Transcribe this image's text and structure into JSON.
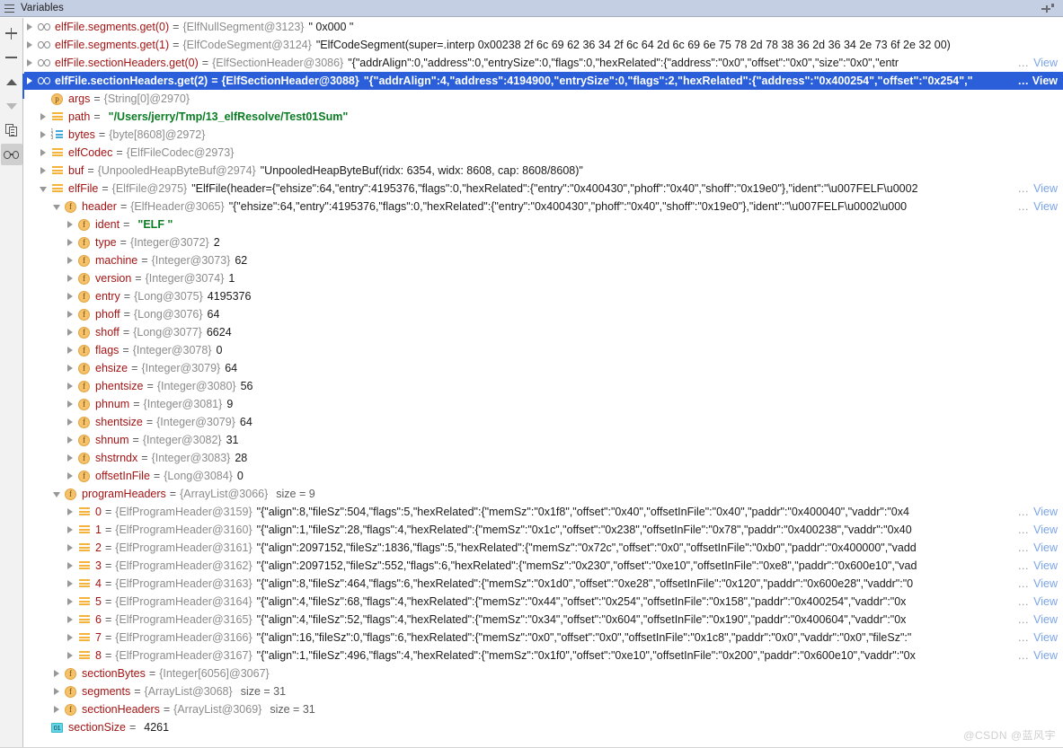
{
  "window": {
    "title": "Variables",
    "menu_icon": "hamburger-icon",
    "settings_icon": "pin-settings-icon"
  },
  "toolbar": {
    "buttons": [
      {
        "name": "add-watch-button",
        "glyph": "+",
        "label": "Add"
      },
      {
        "name": "remove-watch-button",
        "glyph": "−",
        "label": "Remove"
      },
      {
        "name": "move-up-button",
        "glyph": "▲",
        "label": "Up"
      },
      {
        "name": "move-down-button",
        "glyph": "▼",
        "label": "Down"
      },
      {
        "name": "copy-value-button",
        "glyph": "copy",
        "label": "Copy Value"
      },
      {
        "name": "watches-toggle-button",
        "glyph": "oo",
        "label": "Watches"
      }
    ]
  },
  "labels": {
    "equals": "=",
    "view": "View",
    "ellipsis": "…",
    "size_prefix": "size = "
  },
  "watermark": {
    "text": "@CSDN @蓝风宇"
  },
  "rows": [
    {
      "indent": 0,
      "arrow": "closed",
      "icon": "watch",
      "name": "elfFile.segments.get(0)",
      "type": "{ElfNullSegment@3123}",
      "value": "\" 0x000 \"",
      "value_kind": "plain",
      "view": false
    },
    {
      "indent": 0,
      "arrow": "closed",
      "icon": "watch",
      "name": "elfFile.segments.get(1)",
      "type": "{ElfCodeSegment@3124}",
      "value": "\"ElfCodeSegment(super=.interp 0x00238  2f 6c 69 62 36 34 2f 6c 64 2d 6c 69 6e 75 78 2d 78 38 36 2d 36 34 2e 73 6f 2e 32 00)",
      "value_kind": "plain",
      "view": false
    },
    {
      "indent": 0,
      "arrow": "closed",
      "icon": "watch",
      "name": "elfFile.sectionHeaders.get(0)",
      "type": "{ElfSectionHeader@3086}",
      "value": "\"{\"addrAlign\":0,\"address\":0,\"entrySize\":0,\"flags\":0,\"hexRelated\":{\"address\":\"0x0\",\"offset\":\"0x0\",\"size\":\"0x0\",\"entr",
      "value_kind": "plain",
      "view": true
    },
    {
      "indent": 0,
      "arrow": "closed",
      "icon": "watch",
      "name": "elfFile.sectionHeaders.get(2)",
      "type": "{ElfSectionHeader@3088}",
      "value": "\"{\"addrAlign\":4,\"address\":4194900,\"entrySize\":0,\"flags\":2,\"hexRelated\":{\"address\":\"0x400254\",\"offset\":\"0x254\",\"",
      "value_kind": "plain",
      "view": true,
      "selected": true
    },
    {
      "indent": 1,
      "arrow": "none",
      "icon": "param",
      "name": "args",
      "type": "{String[0]@2970}",
      "value": "",
      "value_kind": "plain",
      "view": false
    },
    {
      "indent": 1,
      "arrow": "closed",
      "icon": "object",
      "name": "path",
      "type": "",
      "value": "\"/Users/jerry/Tmp/13_elfResolve/Test01Sum\"",
      "value_kind": "string",
      "view": false
    },
    {
      "indent": 1,
      "arrow": "closed",
      "icon": "array",
      "name": "bytes",
      "type": "{byte[8608]@2972}",
      "value": "",
      "value_kind": "plain",
      "view": false
    },
    {
      "indent": 1,
      "arrow": "closed",
      "icon": "object",
      "name": "elfCodec",
      "type": "{ElfFileCodec@2973}",
      "value": "",
      "value_kind": "plain",
      "view": false
    },
    {
      "indent": 1,
      "arrow": "closed",
      "icon": "object",
      "name": "buf",
      "type": "{UnpooledHeapByteBuf@2974}",
      "value": "\"UnpooledHeapByteBuf(ridx: 6354, widx: 8608, cap: 8608/8608)\"",
      "value_kind": "plain",
      "view": false
    },
    {
      "indent": 1,
      "arrow": "open",
      "icon": "object",
      "name": "elfFile",
      "type": "{ElfFile@2975}",
      "value": "\"ElfFile(header={\"ehsize\":64,\"entry\":4195376,\"flags\":0,\"hexRelated\":{\"entry\":\"0x400430\",\"phoff\":\"0x40\",\"shoff\":\"0x19e0\"},\"ident\":\"\\u007FELF\\u0002",
      "value_kind": "plain",
      "view": true
    },
    {
      "indent": 2,
      "arrow": "open",
      "icon": "field",
      "name": "header",
      "type": "{ElfHeader@3065}",
      "value": "\"{\"ehsize\":64,\"entry\":4195376,\"flags\":0,\"hexRelated\":{\"entry\":\"0x400430\",\"phoff\":\"0x40\",\"shoff\":\"0x19e0\"},\"ident\":\"\\u007FELF\\u0002\\u000",
      "value_kind": "plain",
      "view": true
    },
    {
      "indent": 3,
      "arrow": "closed",
      "icon": "field",
      "name": "ident",
      "type": "",
      "value": "\"ELF \"",
      "value_kind": "string",
      "view": false
    },
    {
      "indent": 3,
      "arrow": "closed",
      "icon": "field",
      "name": "type",
      "type": "{Integer@3072}",
      "value": "2",
      "value_kind": "num",
      "view": false
    },
    {
      "indent": 3,
      "arrow": "closed",
      "icon": "field",
      "name": "machine",
      "type": "{Integer@3073}",
      "value": "62",
      "value_kind": "num",
      "view": false
    },
    {
      "indent": 3,
      "arrow": "closed",
      "icon": "field",
      "name": "version",
      "type": "{Integer@3074}",
      "value": "1",
      "value_kind": "num",
      "view": false
    },
    {
      "indent": 3,
      "arrow": "closed",
      "icon": "field",
      "name": "entry",
      "type": "{Long@3075}",
      "value": "4195376",
      "value_kind": "num",
      "view": false
    },
    {
      "indent": 3,
      "arrow": "closed",
      "icon": "field",
      "name": "phoff",
      "type": "{Long@3076}",
      "value": "64",
      "value_kind": "num",
      "view": false
    },
    {
      "indent": 3,
      "arrow": "closed",
      "icon": "field",
      "name": "shoff",
      "type": "{Long@3077}",
      "value": "6624",
      "value_kind": "num",
      "view": false
    },
    {
      "indent": 3,
      "arrow": "closed",
      "icon": "field",
      "name": "flags",
      "type": "{Integer@3078}",
      "value": "0",
      "value_kind": "num",
      "view": false
    },
    {
      "indent": 3,
      "arrow": "closed",
      "icon": "field",
      "name": "ehsize",
      "type": "{Integer@3079}",
      "value": "64",
      "value_kind": "num",
      "view": false
    },
    {
      "indent": 3,
      "arrow": "closed",
      "icon": "field",
      "name": "phentsize",
      "type": "{Integer@3080}",
      "value": "56",
      "value_kind": "num",
      "view": false
    },
    {
      "indent": 3,
      "arrow": "closed",
      "icon": "field",
      "name": "phnum",
      "type": "{Integer@3081}",
      "value": "9",
      "value_kind": "num",
      "view": false
    },
    {
      "indent": 3,
      "arrow": "closed",
      "icon": "field",
      "name": "shentsize",
      "type": "{Integer@3079}",
      "value": "64",
      "value_kind": "num",
      "view": false
    },
    {
      "indent": 3,
      "arrow": "closed",
      "icon": "field",
      "name": "shnum",
      "type": "{Integer@3082}",
      "value": "31",
      "value_kind": "num",
      "view": false
    },
    {
      "indent": 3,
      "arrow": "closed",
      "icon": "field",
      "name": "shstrndx",
      "type": "{Integer@3083}",
      "value": "28",
      "value_kind": "num",
      "view": false
    },
    {
      "indent": 3,
      "arrow": "closed",
      "icon": "field",
      "name": "offsetInFile",
      "type": "{Long@3084}",
      "value": "0",
      "value_kind": "num",
      "view": false
    },
    {
      "indent": 2,
      "arrow": "open",
      "icon": "field",
      "name": "programHeaders",
      "type": "{ArrayList@3066}",
      "value": "",
      "value_kind": "plain",
      "size": "size = 9",
      "view": false
    },
    {
      "indent": 3,
      "arrow": "closed",
      "icon": "object",
      "name": "0",
      "type": "{ElfProgramHeader@3159}",
      "value": "\"{\"align\":8,\"fileSz\":504,\"flags\":5,\"hexRelated\":{\"memSz\":\"0x1f8\",\"offset\":\"0x40\",\"offsetInFile\":\"0x40\",\"paddr\":\"0x400040\",\"vaddr\":\"0x4",
      "value_kind": "plain",
      "view": true
    },
    {
      "indent": 3,
      "arrow": "closed",
      "icon": "object",
      "name": "1",
      "type": "{ElfProgramHeader@3160}",
      "value": "\"{\"align\":1,\"fileSz\":28,\"flags\":4,\"hexRelated\":{\"memSz\":\"0x1c\",\"offset\":\"0x238\",\"offsetInFile\":\"0x78\",\"paddr\":\"0x400238\",\"vaddr\":\"0x40",
      "value_kind": "plain",
      "view": true
    },
    {
      "indent": 3,
      "arrow": "closed",
      "icon": "object",
      "name": "2",
      "type": "{ElfProgramHeader@3161}",
      "value": "\"{\"align\":2097152,\"fileSz\":1836,\"flags\":5,\"hexRelated\":{\"memSz\":\"0x72c\",\"offset\":\"0x0\",\"offsetInFile\":\"0xb0\",\"paddr\":\"0x400000\",\"vadd",
      "value_kind": "plain",
      "view": true
    },
    {
      "indent": 3,
      "arrow": "closed",
      "icon": "object",
      "name": "3",
      "type": "{ElfProgramHeader@3162}",
      "value": "\"{\"align\":2097152,\"fileSz\":552,\"flags\":6,\"hexRelated\":{\"memSz\":\"0x230\",\"offset\":\"0xe10\",\"offsetInFile\":\"0xe8\",\"paddr\":\"0x600e10\",\"vad",
      "value_kind": "plain",
      "view": true
    },
    {
      "indent": 3,
      "arrow": "closed",
      "icon": "object",
      "name": "4",
      "type": "{ElfProgramHeader@3163}",
      "value": "\"{\"align\":8,\"fileSz\":464,\"flags\":6,\"hexRelated\":{\"memSz\":\"0x1d0\",\"offset\":\"0xe28\",\"offsetInFile\":\"0x120\",\"paddr\":\"0x600e28\",\"vaddr\":\"0",
      "value_kind": "plain",
      "view": true
    },
    {
      "indent": 3,
      "arrow": "closed",
      "icon": "object",
      "name": "5",
      "type": "{ElfProgramHeader@3164}",
      "value": "\"{\"align\":4,\"fileSz\":68,\"flags\":4,\"hexRelated\":{\"memSz\":\"0x44\",\"offset\":\"0x254\",\"offsetInFile\":\"0x158\",\"paddr\":\"0x400254\",\"vaddr\":\"0x",
      "value_kind": "plain",
      "view": true
    },
    {
      "indent": 3,
      "arrow": "closed",
      "icon": "object",
      "name": "6",
      "type": "{ElfProgramHeader@3165}",
      "value": "\"{\"align\":4,\"fileSz\":52,\"flags\":4,\"hexRelated\":{\"memSz\":\"0x34\",\"offset\":\"0x604\",\"offsetInFile\":\"0x190\",\"paddr\":\"0x400604\",\"vaddr\":\"0x",
      "value_kind": "plain",
      "view": true
    },
    {
      "indent": 3,
      "arrow": "closed",
      "icon": "object",
      "name": "7",
      "type": "{ElfProgramHeader@3166}",
      "value": "\"{\"align\":16,\"fileSz\":0,\"flags\":6,\"hexRelated\":{\"memSz\":\"0x0\",\"offset\":\"0x0\",\"offsetInFile\":\"0x1c8\",\"paddr\":\"0x0\",\"vaddr\":\"0x0\",\"fileSz\":\"",
      "value_kind": "plain",
      "view": true
    },
    {
      "indent": 3,
      "arrow": "closed",
      "icon": "object",
      "name": "8",
      "type": "{ElfProgramHeader@3167}",
      "value": "\"{\"align\":1,\"fileSz\":496,\"flags\":4,\"hexRelated\":{\"memSz\":\"0x1f0\",\"offset\":\"0xe10\",\"offsetInFile\":\"0x200\",\"paddr\":\"0x600e10\",\"vaddr\":\"0x",
      "value_kind": "plain",
      "view": true
    },
    {
      "indent": 2,
      "arrow": "closed",
      "icon": "field",
      "name": "sectionBytes",
      "type": "{Integer[6056]@3067}",
      "value": "",
      "value_kind": "plain",
      "view": false
    },
    {
      "indent": 2,
      "arrow": "closed",
      "icon": "field",
      "name": "segments",
      "type": "{ArrayList@3068}",
      "value": "",
      "value_kind": "plain",
      "size": "size = 31",
      "view": false
    },
    {
      "indent": 2,
      "arrow": "closed",
      "icon": "field",
      "name": "sectionHeaders",
      "type": "{ArrayList@3069}",
      "value": "",
      "value_kind": "plain",
      "size": "size = 31",
      "view": false
    },
    {
      "indent": 1,
      "arrow": "none",
      "icon": "primitive",
      "name": "sectionSize",
      "type": "",
      "value": "4261",
      "value_kind": "num",
      "view": false
    }
  ]
}
